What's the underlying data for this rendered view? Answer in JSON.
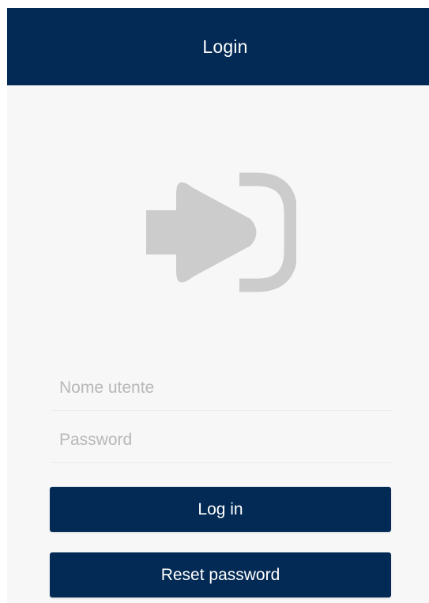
{
  "header": {
    "title": "Login"
  },
  "graphic": {
    "icon": "login-arrow-icon",
    "color": "#cccccc"
  },
  "form": {
    "username_placeholder": "Nome utente",
    "username_value": "",
    "password_placeholder": "Password",
    "password_value": ""
  },
  "buttons": {
    "login_label": "Log in",
    "reset_label": "Reset password"
  },
  "colors": {
    "primary": "#022a55",
    "background": "#f7f7f7",
    "placeholder": "#b8b8b8"
  }
}
